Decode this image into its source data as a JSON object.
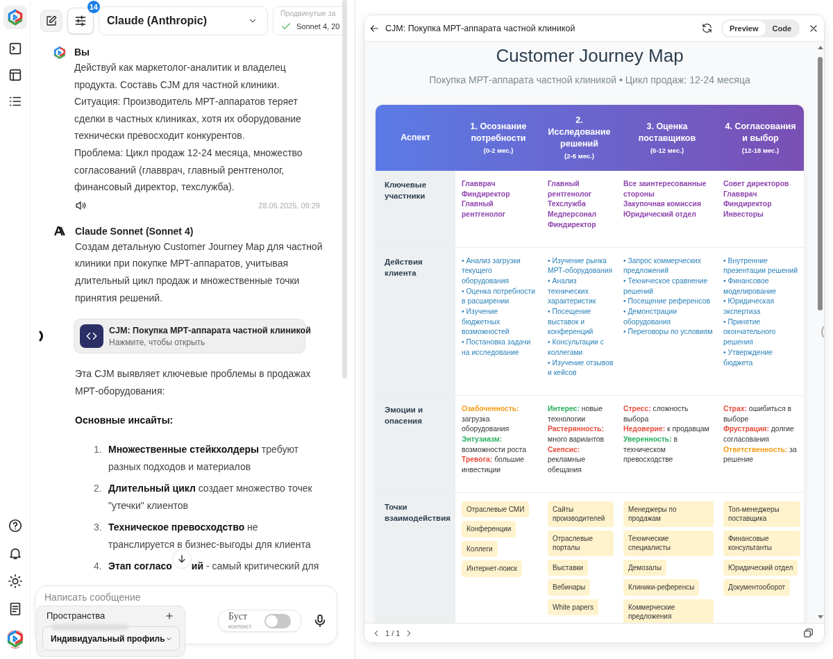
{
  "toolbar": {
    "settings_badge": "14",
    "model": "Claude (Anthropic)",
    "advanced": {
      "title": "Продвинутые за",
      "value": "Sonnet 4, 20"
    }
  },
  "messages": [
    {
      "kind": "user",
      "author": "Вы",
      "paragraphs": [
        "Действуй как маркетолог-аналитик и владелец продукта. Составь CJM для частной клиники.",
        "Ситуация: Производитель МРТ-аппаратов теряет сделки в частных клиниках, хотя их оборудование технически превосходит конкурентов.",
        "Проблема: Цикл продаж 12-24 месяца, множество согласований (главврач, главный рентгенолог, финансовый директор, техслужба)."
      ],
      "time": "28.05.2025, 09:29"
    },
    {
      "kind": "assistant",
      "author": "Claude Sonnet (Sonnet 4)",
      "paragraphs": [
        "Создам детальную Customer Journey Map для частной клиники при покупке МРТ-аппаратов, учитывая длительный цикл продаж и множественные точки принятия решений."
      ],
      "artifact": {
        "title": "CJM: Покупка МРТ-аппарата частной клиникой",
        "subtitle": "Нажмите, чтобы открыть"
      },
      "after": [
        "Эта CJM выявляет ключевые проблемы в продажах МРТ-оборудования:"
      ],
      "heading": "Основные инсайты:",
      "list": [
        {
          "number": "1.",
          "text": "**Множественные стейкхолдеры** требуют разных подходов и материалов"
        },
        {
          "number": "2.",
          "text": "**Длительный цикл** создает множество точек \"утечки\" клиентов"
        },
        {
          "number": "3.",
          "text": "**Техническое превосходство** не транслируется в бизнес-выгоды для клиента"
        },
        {
          "number": "4.",
          "parts": [
            "**Этап согласо**",
            "**ий** - самый критический для"
          ]
        }
      ]
    }
  ],
  "composer": {
    "placeholder": "Написать сообщение",
    "boost": {
      "label": "Буст",
      "caption": "контекст",
      "on": false
    }
  },
  "spaces": {
    "title": "Пространства",
    "profile": "Индивидуальный профиль"
  },
  "preview": {
    "title": "CJM: Покупка МРТ-аппарата частной клиникой",
    "tabs": [
      {
        "label": "Preview",
        "selected": true
      },
      {
        "label": "Code",
        "selected": false
      }
    ],
    "pager": "1 / 1",
    "doc": {
      "title": "Customer Journey Map",
      "subtitle": "Покупка МРТ-аппарата частной клиникой • Цикл продаж: 12-24 месяца",
      "columns": [
        {
          "title": "Аспект"
        },
        {
          "title": "1. Осознание потребности",
          "period": "(0-2 мес.)"
        },
        {
          "title": "2. Исследование решений",
          "period": "(2-6 мес.)"
        },
        {
          "title": "3. Оценка поставщиков",
          "period": "(6-12 мес.)"
        },
        {
          "title": "4. Согласования и выбор",
          "period": "(12-18 мес.)"
        }
      ],
      "rows": [
        {
          "kind": "people",
          "cells": [
            "Ключевые участники",
            [
              "Главврач",
              "Финдиректор",
              "Главный рентгенолог"
            ],
            [
              "Главный рентгенолог",
              "Техслужба",
              "Медперсонал",
              "Финдиректор"
            ],
            [
              "Все заинтересованные стороны",
              "Закупочная комиссия",
              "Юридический отдел"
            ],
            [
              "Совет директоров",
              "Главврач",
              "Финдиректор",
              "Инвесторы"
            ]
          ]
        },
        {
          "kind": "actions",
          "cells": [
            "Действия клиента",
            [
              "• Анализ загрузки текущего оборудования",
              "• Оценка потребности в расширении",
              "• Изучение бюджетных возможностей",
              "• Постановка задачи на исследование"
            ],
            [
              "• Изучение рынка МРТ-оборудования",
              "• Анализ технических характеристик",
              "• Посещение выставок и конференций",
              "• Консультации с коллегами",
              "• Изучение отзывов и кейсов"
            ],
            [
              "• Запрос коммерческих предложений",
              "• Техническое сравнение решений",
              "• Посещение референсов",
              "• Демонстрации оборудования",
              "• Переговоры по условиям"
            ],
            [
              "• Внутренние презентации решений",
              "• Финансовое моделирование",
              "• Юридическая экспертиза",
              "• Принятие окончательного решения",
              "• Утверждение бюджета"
            ]
          ]
        },
        {
          "kind": "emotions",
          "cells": [
            "Эмоции и опасения",
            [
              {
                "label": "Озабоченность:",
                "text": "загрузка оборудования",
                "color": "#f39c12"
              },
              {
                "label": "Энтузиазм:",
                "text": "возможности роста",
                "color": "#27ae60"
              },
              {
                "label": "Тревога:",
                "text": "большие инвестиции",
                "color": "#e74c3c"
              }
            ],
            [
              {
                "label": "Интерес:",
                "text": "новые технологии",
                "color": "#27ae60"
              },
              {
                "label": "Растерянность:",
                "text": "много вариантов",
                "color": "#e74c3c"
              },
              {
                "label": "Скепсис:",
                "text": "рекламные обещания",
                "color": "#e74c3c"
              }
            ],
            [
              {
                "label": "Стресс:",
                "text": "сложность выбора",
                "color": "#e74c3c"
              },
              {
                "label": "Недоверие:",
                "text": "к продавцам",
                "color": "#e74c3c"
              },
              {
                "label": "Уверенность:",
                "text": "в техническом превосходстве",
                "color": "#27ae60"
              }
            ],
            [
              {
                "label": "Страх:",
                "text": "ошибиться в выборе",
                "color": "#e74c3c"
              },
              {
                "label": "Фрустрация:",
                "text": "долгие согласования",
                "color": "#e74c3c"
              },
              {
                "label": "Ответственность:",
                "text": "за решение",
                "color": "#f39c12"
              }
            ]
          ]
        },
        {
          "kind": "touchpoints",
          "cells": [
            "Точки взаимодействия",
            [
              "Отраслевые СМИ",
              "Конференции",
              "Коллеги",
              "Интернет-поиск"
            ],
            [
              "Сайты производителей",
              "Отраслевые порталы",
              "Выставки",
              "Вебинары",
              "White papers"
            ],
            [
              "Менеджеры по продажам",
              "Технические специалисты",
              "Демозалы",
              "Клиники-референсы",
              "Коммерческие предложения"
            ],
            [
              "Топ-менеджеры поставщика",
              "Финансовые консультанты",
              "Юридический отдел",
              "Документооборот"
            ]
          ]
        }
      ]
    }
  }
}
